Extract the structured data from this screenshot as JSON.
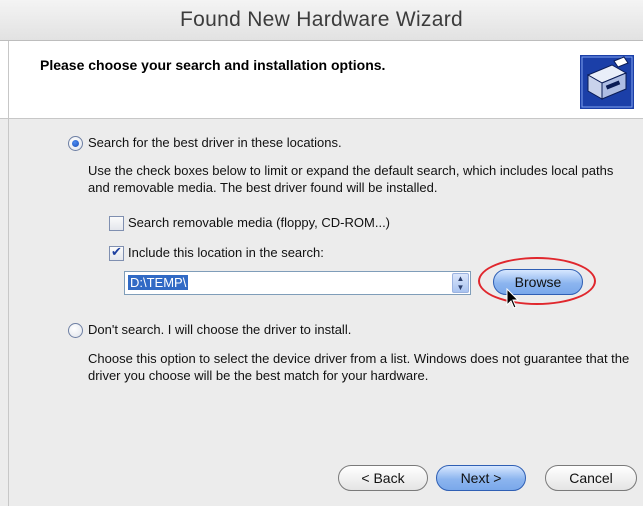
{
  "window": {
    "title": "Found New Hardware Wizard"
  },
  "header": {
    "title": "Please choose your search and installation options.",
    "icon": "hardware-wizard-icon"
  },
  "options": {
    "search_label": "Search for the best driver in these locations.",
    "search_selected": true,
    "search_description": "Use the check boxes below to limit or expand the default search, which includes local paths and removable media. The best driver found will be installed.",
    "removable_label": "Search removable media (floppy, CD-ROM...)",
    "removable_checked": false,
    "include_location_label": "Include this location in the search:",
    "include_location_checked": true,
    "location_value": "D:\\TEMP\\",
    "browse_label": "Browse",
    "dont_search_label": "Don't search. I will choose the driver to install.",
    "dont_search_selected": false,
    "dont_search_description": "Choose this option to select the device driver from a list.  Windows does not guarantee that the driver you choose will be the best match for your hardware."
  },
  "footer": {
    "back_label": "< Back",
    "next_label": "Next >",
    "cancel_label": "Cancel"
  },
  "colors": {
    "highlight_ring": "#e0272d",
    "primary_button": "#8cb5ef",
    "selection": "#316ac5"
  }
}
